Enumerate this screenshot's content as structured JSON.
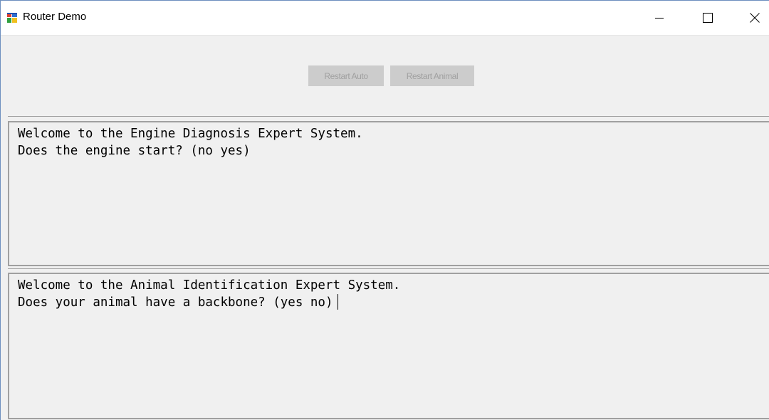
{
  "window": {
    "title": "Router Demo",
    "icon": "winforms-app-icon"
  },
  "caption_buttons": {
    "minimize": "minimize-icon",
    "maximize": "maximize-icon",
    "close": "close-icon"
  },
  "toolbar": {
    "restart_auto_label": "Restart Auto",
    "restart_animal_label": "Restart Animal",
    "buttons_enabled": false
  },
  "auto_console": {
    "lines": [
      "Welcome to the Engine Diagnosis Expert System.",
      "Does the engine start? (no yes)"
    ]
  },
  "animal_console": {
    "lines": [
      "Welcome to the Animal Identification Expert System.",
      "Does your animal have a backbone? (yes no)"
    ],
    "has_caret": true
  },
  "colors": {
    "background": "#f0f0f0",
    "titlebar": "#ffffff",
    "disabled_button": "#cccccc",
    "disabled_text": "#a0a0a0",
    "border": "#a0a0a0"
  }
}
